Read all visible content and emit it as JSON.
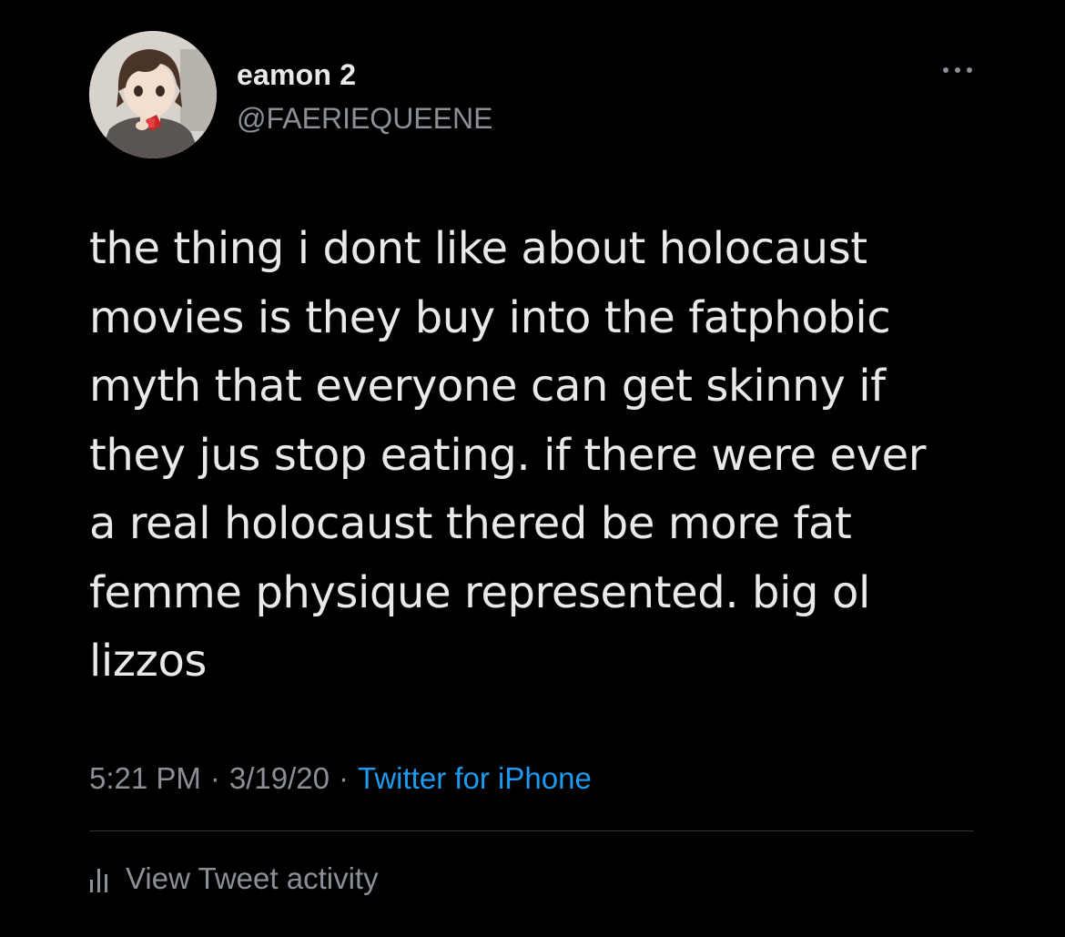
{
  "author": {
    "display_name": "eamon 2",
    "handle": "@FAERIEQUEENE"
  },
  "more_icon": "more-horizontal-icon",
  "tweet": {
    "text": "the thing i dont like about holocaust\nmovies is they buy into the fatphobic\nmyth that everyone can get skinny if\nthey jus stop eating. if there were ever\na real holocaust thered be more fat\nfemme physique represented. big ol\nlizzos"
  },
  "meta": {
    "time": "5:21 PM",
    "separator": "·",
    "date": "3/19/20",
    "source": "Twitter for iPhone"
  },
  "activity": {
    "icon": "bar-chart-icon",
    "label": "View Tweet activity"
  },
  "colors": {
    "background": "#000000",
    "primary_text": "#e7e9ea",
    "secondary_text": "#8b9097",
    "link": "#1d9bf0",
    "divider": "#2f3336"
  }
}
